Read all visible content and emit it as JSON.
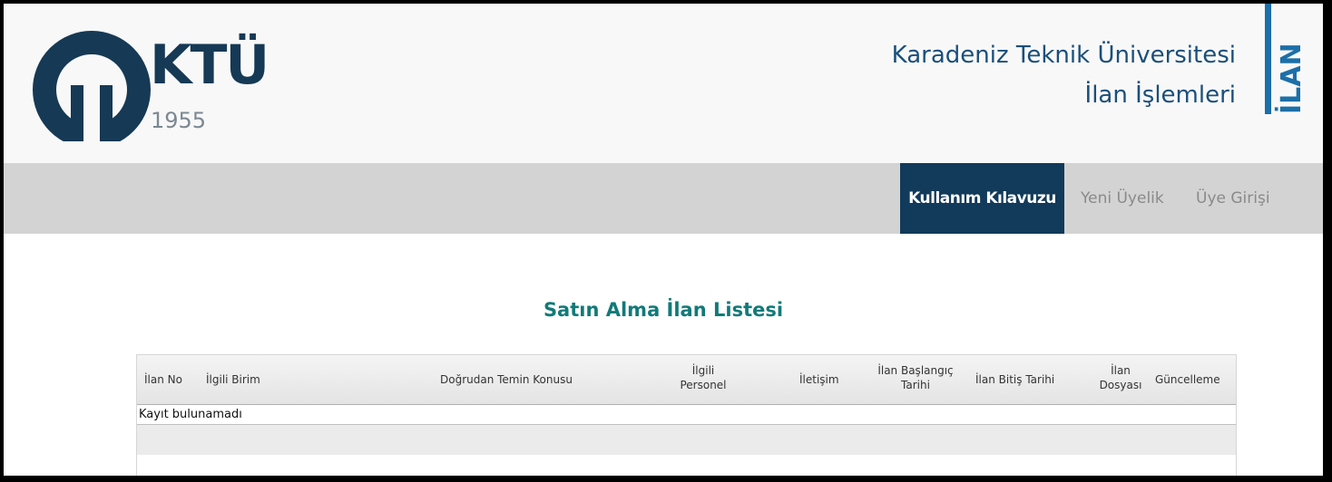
{
  "header": {
    "logo_text": "KTÜ",
    "logo_year": "1955",
    "university_name": "Karadeniz Teknik Üniversitesi",
    "subtitle": "İlan İşlemleri",
    "vertical_label": "İLAN",
    "brand_color": "#163955",
    "accent_color": "#1c6fa8"
  },
  "nav": {
    "items": [
      {
        "label": "Kullanım Kılavuzu",
        "active": true
      },
      {
        "label": "Yeni Üyelik",
        "active": false
      },
      {
        "label": "Üye Girişi",
        "active": false
      }
    ],
    "active_bg": "#123a5a"
  },
  "main": {
    "title": "Satın Alma İlan Listesi",
    "table": {
      "columns": [
        "İlan No",
        "İlgili Birim",
        "Doğrudan Temin Konusu",
        "İlgili Personel",
        "İletişim",
        "İlan Başlangıç Tarihi",
        "İlan Bitiş Tarihi",
        "İlan Dosyası",
        "Güncelleme"
      ],
      "empty_message": "Kayıt bulunamadı"
    }
  }
}
